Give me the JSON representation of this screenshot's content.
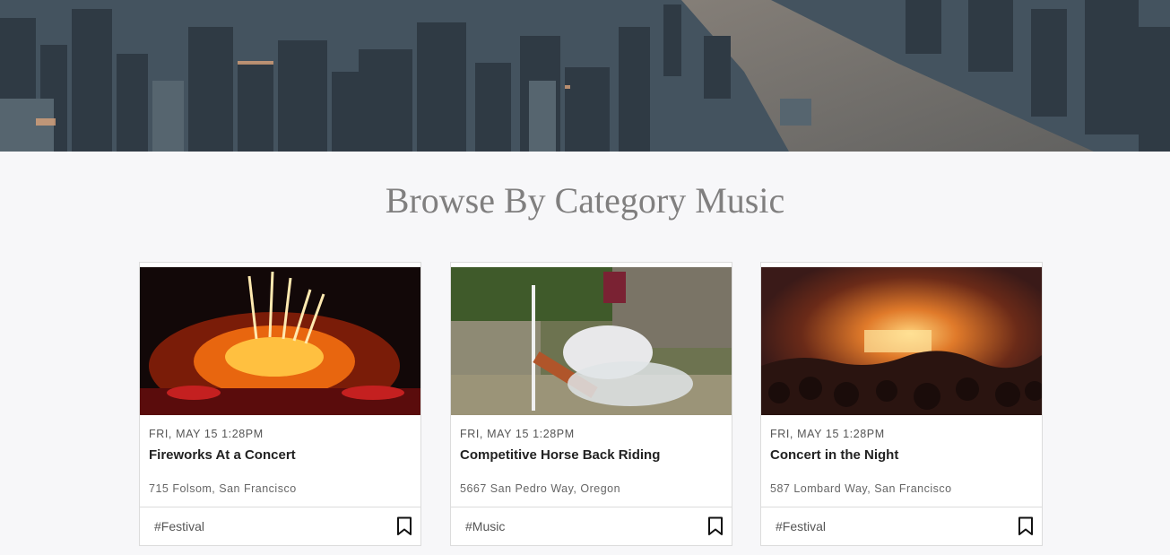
{
  "page": {
    "title": "Browse By Category Music"
  },
  "events": [
    {
      "date": "FRI, MAY 15 1:28PM",
      "title": "Fireworks At a Concert",
      "address": "715 Folsom, San Francisco",
      "tag": "#Festival",
      "image": "fireworks-concert-photo"
    },
    {
      "date": "FRI, MAY 15 1:28PM",
      "title": "Competitive Horse Back Riding",
      "address": "5667 San Pedro Way, Oregon",
      "tag": "#Music",
      "image": "horse-jump-photo"
    },
    {
      "date": "FRI, MAY 15 1:28PM",
      "title": "Concert in the Night",
      "address": "587 Lombard Way, San Francisco",
      "tag": "#Festival",
      "image": "night-concert-photo"
    }
  ],
  "icons": {
    "bookmark": "bookmark-icon"
  }
}
